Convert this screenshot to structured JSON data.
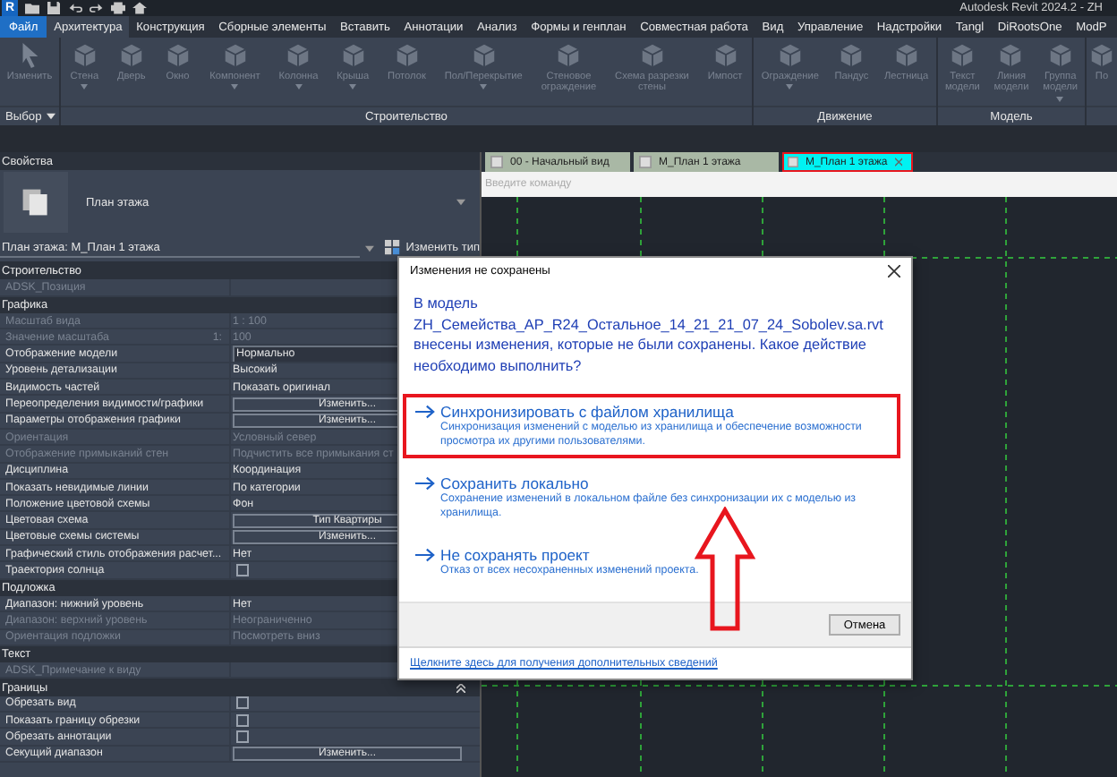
{
  "title_bar": {
    "logo": "R",
    "title": "Autodesk Revit 2024.2 - ZH"
  },
  "menu": [
    {
      "label": "Файл",
      "kind": "file",
      "selected": false
    },
    {
      "label": "Архитектура",
      "kind": "tab",
      "selected": true
    },
    {
      "label": "Конструкция",
      "kind": "tab",
      "selected": false
    },
    {
      "label": "Сборные элементы",
      "kind": "tab",
      "selected": false
    },
    {
      "label": "Вставить",
      "kind": "tab",
      "selected": false
    },
    {
      "label": "Аннотации",
      "kind": "tab",
      "selected": false
    },
    {
      "label": "Анализ",
      "kind": "tab",
      "selected": false
    },
    {
      "label": "Формы и генплан",
      "kind": "tab",
      "selected": false
    },
    {
      "label": "Совместная работа",
      "kind": "tab",
      "selected": false
    },
    {
      "label": "Вид",
      "kind": "tab",
      "selected": false
    },
    {
      "label": "Управление",
      "kind": "tab",
      "selected": false
    },
    {
      "label": "Надстройки",
      "kind": "tab",
      "selected": false
    },
    {
      "label": "Tangl",
      "kind": "tab",
      "selected": false
    },
    {
      "label": "DiRootsOne",
      "kind": "tab",
      "selected": false
    },
    {
      "label": "ModP",
      "kind": "tab",
      "selected": false
    }
  ],
  "ribbon": [
    {
      "label": "Выбор",
      "menu": true,
      "tools": [
        {
          "label": "Изменить",
          "disabled": true,
          "dropdown": false
        }
      ]
    },
    {
      "label": "Строительство",
      "menu": false,
      "tools": [
        {
          "label": "Стена",
          "disabled": true,
          "dropdown": true
        },
        {
          "label": "Дверь",
          "disabled": true,
          "dropdown": false
        },
        {
          "label": "Окно",
          "disabled": true,
          "dropdown": false
        },
        {
          "label": "Компонент",
          "disabled": true,
          "dropdown": true
        },
        {
          "label": "Колонна",
          "disabled": true,
          "dropdown": true
        },
        {
          "label": "Крыша",
          "disabled": true,
          "dropdown": true
        },
        {
          "label": "Потолок",
          "disabled": true,
          "dropdown": false
        },
        {
          "label": "Пол/Перекрытие",
          "disabled": true,
          "dropdown": true
        },
        {
          "label": "Стеновое\nограждение",
          "disabled": true,
          "dropdown": false
        },
        {
          "label": "Схема разрезки\nстены",
          "disabled": true,
          "dropdown": false
        },
        {
          "label": "Импост",
          "disabled": true,
          "dropdown": false
        }
      ]
    },
    {
      "label": "Движение",
      "menu": false,
      "tools": [
        {
          "label": "Ограждение",
          "disabled": true,
          "dropdown": true
        },
        {
          "label": "Пандус",
          "disabled": true,
          "dropdown": false
        },
        {
          "label": "Лестница",
          "disabled": true,
          "dropdown": false
        }
      ]
    },
    {
      "label": "Модель",
      "menu": false,
      "tools": [
        {
          "label": "Текст\nмодели",
          "disabled": true,
          "dropdown": false
        },
        {
          "label": "Линия\nмодели",
          "disabled": true,
          "dropdown": false
        },
        {
          "label": "Группа\nмодели",
          "disabled": true,
          "dropdown": true
        }
      ]
    },
    {
      "menu": false,
      "tools": [
        {
          "label": "По",
          "disabled": true,
          "dropdown": false
        }
      ]
    }
  ],
  "properties": {
    "title": "Свойства",
    "type_name": "План этажа",
    "selector": "План этажа: М_План 1 этажа",
    "edit_type": "Изменить тип",
    "rows": [
      {
        "kind": "section",
        "label": "Строительство"
      },
      {
        "kind": "text",
        "label": "ADSK_Позиция",
        "disabled": true
      },
      {
        "kind": "section",
        "label": "Графика"
      },
      {
        "kind": "text",
        "label": "Масштаб вида",
        "value": "1 : 100",
        "disabled": true
      },
      {
        "kind": "text",
        "label": "Значение масштаба",
        "suffix": "1:",
        "value": "100",
        "disabled": true
      },
      {
        "kind": "select",
        "label": "Отображение модели",
        "value": "Нормально",
        "disabled": false
      },
      {
        "kind": "text",
        "label": "Уровень детализации",
        "value": "Высокий",
        "disabled": false
      },
      {
        "kind": "text",
        "label": "Видимость частей",
        "value": "Показать оригинал",
        "disabled": false
      },
      {
        "kind": "button",
        "label": "Переопределения видимости/графики",
        "value": "Изменить...",
        "disabled": false
      },
      {
        "kind": "button",
        "label": "Параметры отображения графики",
        "value": "Изменить...",
        "disabled": false
      },
      {
        "kind": "text",
        "label": "Ориентация",
        "value": "Условный север",
        "disabled": true
      },
      {
        "kind": "text",
        "label": "Отображение примыканий стен",
        "value": "Подчистить все примыкания ст",
        "disabled": true
      },
      {
        "kind": "text",
        "label": "Дисциплина",
        "value": "Координация",
        "disabled": false
      },
      {
        "kind": "text",
        "label": "Показать невидимые линии",
        "value": "По категории",
        "disabled": false
      },
      {
        "kind": "text",
        "label": "Положение цветовой схемы",
        "value": "Фон",
        "disabled": false
      },
      {
        "kind": "button",
        "label": "Цветовая схема",
        "value": "Тип Квартиры",
        "disabled": false
      },
      {
        "kind": "button",
        "label": "Цветовые схемы системы",
        "value": "Изменить...",
        "disabled": false
      },
      {
        "kind": "text",
        "label": "Графический стиль отображения расчет...",
        "value": "Нет",
        "disabled": false
      },
      {
        "kind": "check",
        "label": "Траектория солнца",
        "checked": false,
        "disabled": false
      },
      {
        "kind": "section",
        "label": "Подложка"
      },
      {
        "kind": "text",
        "label": "Диапазон: нижний уровень",
        "value": "Нет",
        "disabled": false
      },
      {
        "kind": "text",
        "label": "Диапазон: верхний уровень",
        "value": "Неограниченно",
        "disabled": true
      },
      {
        "kind": "text",
        "label": "Ориентация подложки",
        "value": "Посмотреть вниз",
        "disabled": true
      },
      {
        "kind": "section",
        "label": "Текст"
      },
      {
        "kind": "text",
        "label": "ADSK_Примечание к виду",
        "disabled": true
      },
      {
        "kind": "section",
        "label": "Границы"
      },
      {
        "kind": "check",
        "label": "Обрезать вид",
        "checked": false,
        "disabled": false
      },
      {
        "kind": "check",
        "label": "Показать границу обрезки",
        "checked": false,
        "disabled": false
      },
      {
        "kind": "check",
        "label": "Обрезать аннотации",
        "checked": false,
        "disabled": false
      },
      {
        "kind": "button",
        "label": "Секущий диапазон",
        "value": "Изменить...",
        "disabled": false
      }
    ]
  },
  "view_tabs": [
    {
      "label": "00 - Начальный вид",
      "selected": false
    },
    {
      "label": "М_План 1 этажа",
      "selected": false
    },
    {
      "label": "М_План 1 этажа",
      "selected": true
    }
  ],
  "command": {
    "placeholder": "Введите команду"
  },
  "dialog": {
    "title": "Изменения не сохранены",
    "message": "В модель\nZH_Семейства_АР_R24_Остальное_14_21_21_07_24_Sobolev.sa.rvt\nвнесены изменения, которые не были сохранены. Какое действие\nнеобходимо выполнить?",
    "options": [
      {
        "title": "Синхронизировать с файлом хранилища",
        "description": "Синхронизация изменений с моделью из хранилища и обеспечение возможности просмотра их другими пользователями.",
        "highlighted": true
      },
      {
        "title": "Сохранить локально",
        "description": "Сохранение изменений в локальном файле без синхронизации их с моделью из хранилища.",
        "highlighted": false
      },
      {
        "title": "Не сохранять проект",
        "description": "Отказ от всех несохраненных изменений проекта.",
        "highlighted": false
      }
    ],
    "cancel": "Отмена",
    "link": "Щелкните здесь для получения дополнительных сведений"
  }
}
